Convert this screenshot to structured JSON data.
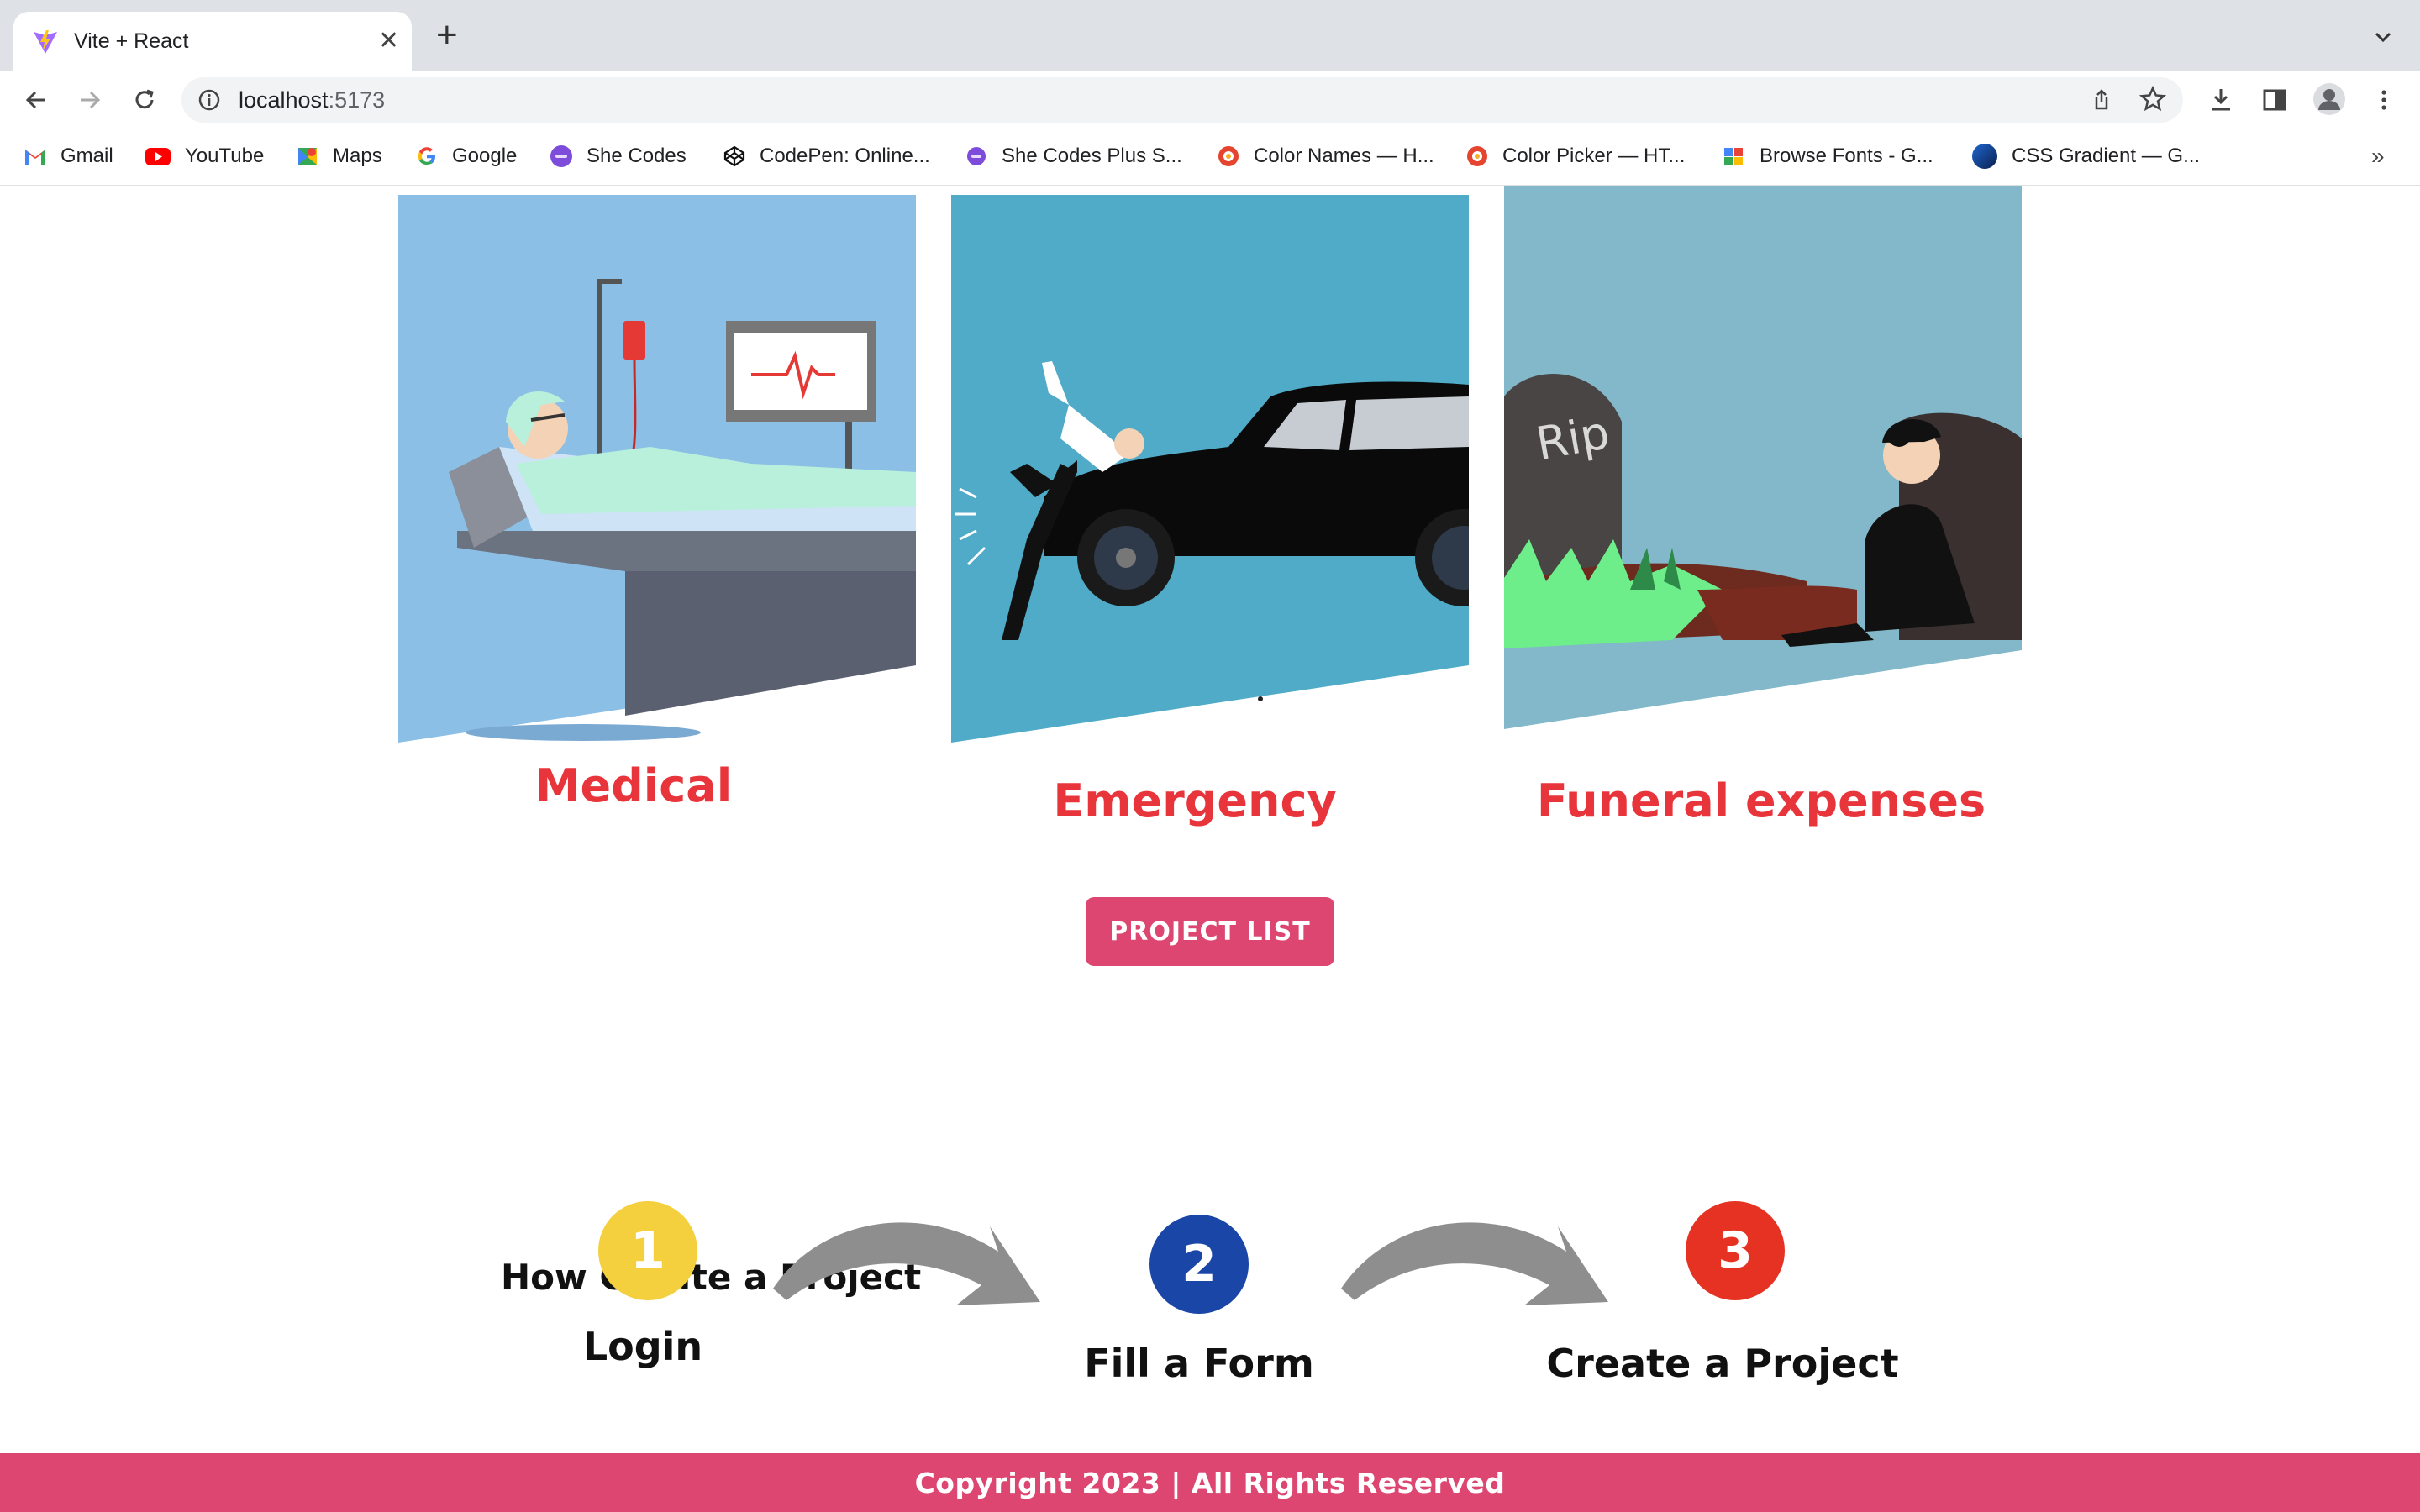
{
  "browser": {
    "tab_title": "Vite + React",
    "url_host": "localhost",
    "url_port": ":5173",
    "bookmarks": [
      {
        "label": "Gmail",
        "icon": "gmail-icon"
      },
      {
        "label": "YouTube",
        "icon": "youtube-icon"
      },
      {
        "label": "Maps",
        "icon": "maps-icon"
      },
      {
        "label": "Google",
        "icon": "google-icon"
      },
      {
        "label": "She Codes",
        "icon": "shecodes-icon"
      },
      {
        "label": "CodePen: Online...",
        "icon": "codepen-icon"
      },
      {
        "label": "She Codes Plus S...",
        "icon": "shecodes-icon"
      },
      {
        "label": "Color Names — H...",
        "icon": "color-icon"
      },
      {
        "label": "Color Picker — HT...",
        "icon": "color-icon"
      },
      {
        "label": "Browse Fonts - G...",
        "icon": "fonts-icon"
      },
      {
        "label": "CSS Gradient — G...",
        "icon": "gradient-icon"
      }
    ],
    "more_bookmarks": "»"
  },
  "cards": [
    {
      "label": "Medical",
      "image": "hospital-patient-illustration"
    },
    {
      "label": "Emergency",
      "image": "car-accident-illustration"
    },
    {
      "label": "Funeral  expenses",
      "image": "grieving-at-grave-illustration"
    }
  ],
  "project_button": "PROJECT LIST",
  "how_to": {
    "title": "How Create a Project",
    "steps": [
      {
        "number": "1",
        "label": "Login",
        "color": "#f4d03f"
      },
      {
        "number": "2",
        "label": "Fill a Form",
        "color": "#1a46a8"
      },
      {
        "number": "3",
        "label": "Create a Project",
        "color": "#e63222"
      }
    ]
  },
  "footer": "Copyright 2023 | All Rights Reserved",
  "colors": {
    "accent": "#dc4670",
    "label_red": "#e8353b"
  }
}
